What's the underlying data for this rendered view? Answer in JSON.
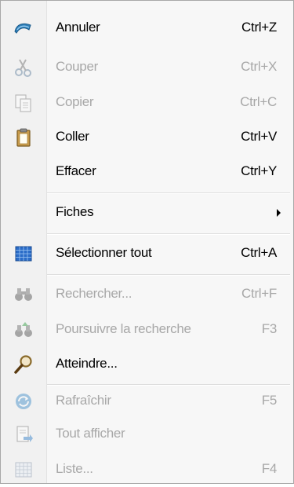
{
  "menu": {
    "items": [
      {
        "label": "Annuler",
        "shortcut": "Ctrl+Z",
        "icon": "undo-icon",
        "enabled": true
      },
      {
        "label": "Couper",
        "shortcut": "Ctrl+X",
        "icon": "scissors-icon",
        "enabled": false
      },
      {
        "label": "Copier",
        "shortcut": "Ctrl+C",
        "icon": "copy-icon",
        "enabled": false
      },
      {
        "label": "Coller",
        "shortcut": "Ctrl+V",
        "icon": "paste-clipboard-icon",
        "enabled": true
      },
      {
        "label": "Effacer",
        "shortcut": "Ctrl+Y",
        "icon": "",
        "enabled": true
      },
      {
        "label": "Fiches",
        "shortcut": "",
        "icon": "",
        "enabled": true,
        "submenu": true
      },
      {
        "label": "Sélectionner tout",
        "shortcut": "Ctrl+A",
        "icon": "select-all-grid-icon",
        "enabled": true
      },
      {
        "label": "Rechercher...",
        "shortcut": "Ctrl+F",
        "icon": "binoculars-icon",
        "enabled": false
      },
      {
        "label": "Poursuivre la recherche",
        "shortcut": "F3",
        "icon": "find-next-binoculars-icon",
        "enabled": false
      },
      {
        "label": "Atteindre...",
        "shortcut": "",
        "icon": "magnifier-icon",
        "enabled": true
      },
      {
        "label": "Rafraîchir",
        "shortcut": "F5",
        "icon": "refresh-icon",
        "enabled": false
      },
      {
        "label": "Tout afficher",
        "shortcut": "",
        "icon": "show-all-icon",
        "enabled": false
      },
      {
        "label": "Liste...",
        "shortcut": "F4",
        "icon": "list-grid-icon",
        "enabled": false
      }
    ]
  },
  "colors": {
    "menu_background": "#f7f7f7",
    "gutter_background": "#f1f1f1",
    "border": "#a8a8a8",
    "disabled_text": "#a8a8a8",
    "enabled_text": "#000000"
  }
}
